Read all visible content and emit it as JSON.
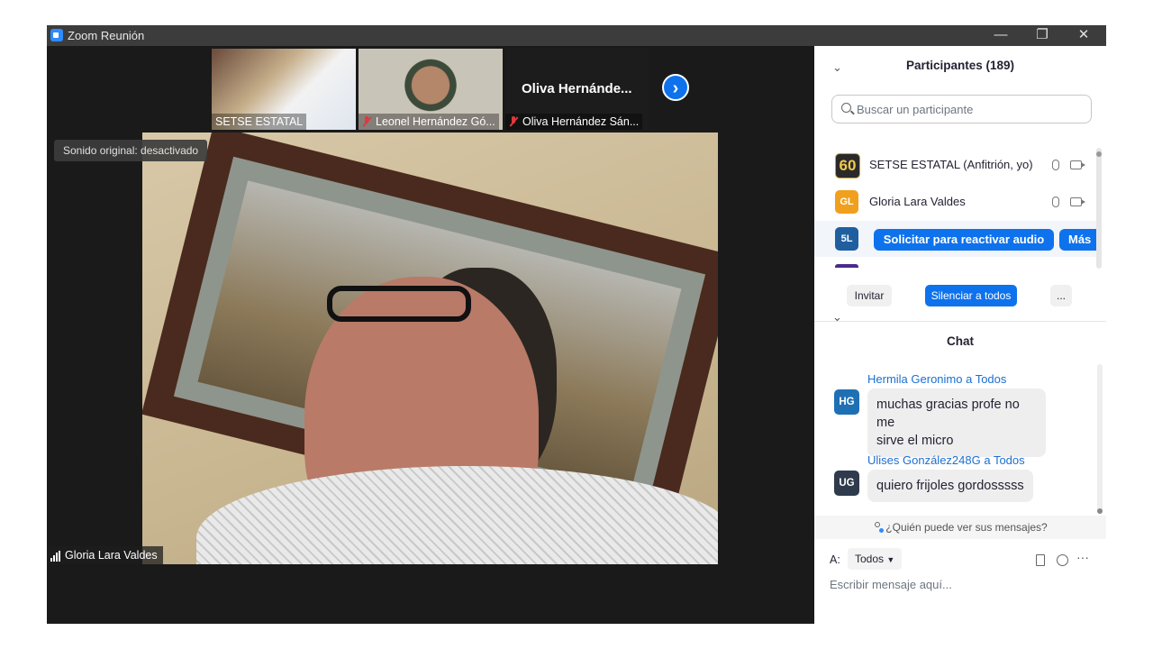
{
  "window": {
    "title": "Zoom Reunión",
    "controls": {
      "minimize": "—",
      "restore": "❐",
      "close": "✕"
    }
  },
  "thumbnails": [
    {
      "name": "SETSE ESTATAL",
      "muted": false
    },
    {
      "name": "Leonel Hernández Gó...",
      "muted": true
    },
    {
      "name": "Oliva Hernández Sán...",
      "display_name": "Oliva Hernánde...",
      "muted": true
    }
  ],
  "next_arrow": "›",
  "sound_badge": "Sonido original: desactivado",
  "main_video": {
    "speaker_name": "Gloria  Lara Valdes"
  },
  "participants": {
    "header": "Participantes (189)",
    "search_placeholder": "Buscar un participante",
    "list": [
      {
        "initials": "60",
        "name": "SETSE ESTATAL (Anfitrión, yo)",
        "avatar_color": "#2a2a2a"
      },
      {
        "initials": "GL",
        "name": "Gloria  Lara Valdes",
        "avatar_color": "#f0a01e"
      },
      {
        "initials": "5L",
        "avatar_color": "#1f5fa0",
        "request_audio": "Solicitar para reactivar audio",
        "more": "Más"
      }
    ],
    "invite": "Invitar",
    "mute_all": "Silenciar a todos",
    "more": "..."
  },
  "chat": {
    "header": "Chat",
    "messages": [
      {
        "initials": "HG",
        "avatar_color": "#1f6fb5",
        "sender": "Hermila Geronimo a Todos",
        "text_lines": [
          "muchas gracias profe no me",
          "sirve el micro"
        ]
      },
      {
        "initials": "UG",
        "avatar_color": "#2f3b4c",
        "sender": "Ulises González248G a Todos",
        "text_lines": [
          "quiero frijoles gordosssss"
        ]
      }
    ],
    "who_can_see": "¿Quién puede ver sus mensajes?",
    "to_label": "A:",
    "to_value": "Todos",
    "composer_placeholder": "Escribir mensaje aquí...",
    "more": "···"
  }
}
